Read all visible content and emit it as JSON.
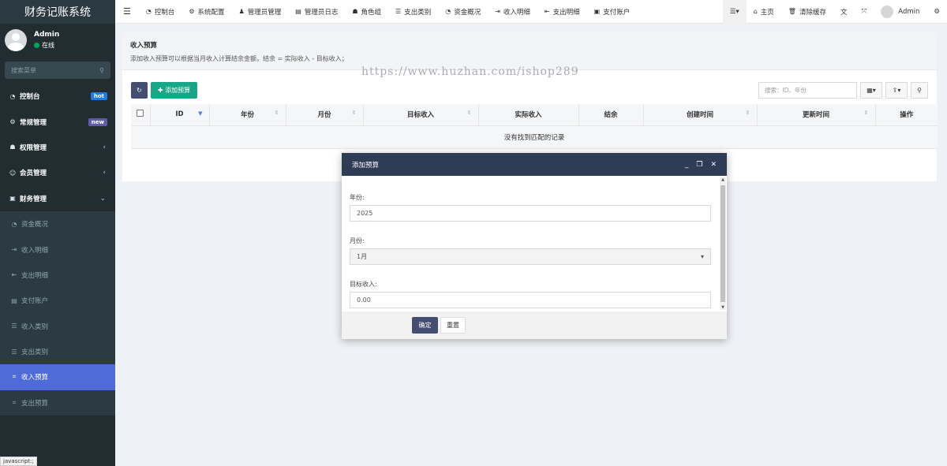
{
  "app": {
    "title": "财务记账系统"
  },
  "user": {
    "name": "Admin",
    "status": "在线"
  },
  "sidebar": {
    "search_placeholder": "搜索菜单",
    "items": [
      {
        "icon": "dashboard-icon",
        "label": "控制台",
        "badge": "hot"
      },
      {
        "icon": "cogs-icon",
        "label": "常规管理",
        "badge": "new"
      },
      {
        "icon": "group-icon",
        "label": "权限管理",
        "caret": "‹"
      },
      {
        "icon": "user-circle-icon",
        "label": "会员管理",
        "caret": "‹"
      },
      {
        "icon": "money-icon",
        "label": "财务管理",
        "caret": "⌄"
      }
    ],
    "subitems": [
      {
        "icon": "dashboard-icon",
        "label": "资金概况"
      },
      {
        "icon": "sign-in-icon",
        "label": "收入明细"
      },
      {
        "icon": "sign-out-icon",
        "label": "支出明细"
      },
      {
        "icon": "account-icon",
        "label": "支付账户"
      },
      {
        "icon": "list-icon",
        "label": "收入类别"
      },
      {
        "icon": "list-icon",
        "label": "支出类别"
      },
      {
        "icon": "budget-icon",
        "label": "收入预算",
        "active": true
      },
      {
        "icon": "budget-icon",
        "label": "支出预算"
      }
    ],
    "status_text": "javascript:;"
  },
  "topnav": {
    "items": [
      "控制台",
      "系统配置",
      "管理员管理",
      "管理员日志",
      "角色组",
      "支出类别",
      "资金概况",
      "收入明细",
      "支出明细",
      "支付账户"
    ],
    "right": {
      "home": "主页",
      "clear_cache": "清除缓存",
      "user": "Admin"
    }
  },
  "panel": {
    "title": "收入预算",
    "description": "添加收入预算可以根据当月收入计算结余金额，结余 = 实际收入 - 目标收入；",
    "add_button": "添加预算",
    "search_placeholder": "搜索：ID、年份",
    "columns": [
      "ID",
      "年份",
      "月份",
      "目标收入",
      "实际收入",
      "结余",
      "创建时间",
      "更新时间",
      "操作"
    ],
    "empty_text": "没有找到匹配的记录"
  },
  "watermark": "https://www.huzhan.com/ishop289",
  "dialog": {
    "title": "添加预算",
    "fields": {
      "year_label": "年份:",
      "year_value": "2025",
      "month_label": "月份:",
      "month_value": "1月",
      "target_label": "目标收入:",
      "target_value": "0.00"
    },
    "ok_button": "确定",
    "reset_button": "重置"
  }
}
